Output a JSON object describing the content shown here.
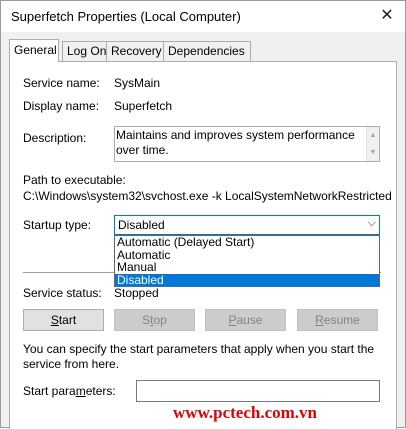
{
  "window": {
    "title": "Superfetch Properties (Local Computer)",
    "close_glyph": "✕"
  },
  "tabs": [
    {
      "label": "General",
      "active": true
    },
    {
      "label": "Log On",
      "active": false
    },
    {
      "label": "Recovery",
      "active": false
    },
    {
      "label": "Dependencies",
      "active": false
    }
  ],
  "general": {
    "service_name_label": "Service name:",
    "service_name_value": "SysMain",
    "display_name_label": "Display name:",
    "display_name_value": "Superfetch",
    "description_label": "Description:",
    "description_value": "Maintains and improves system performance over time.",
    "path_label": "Path to executable:",
    "path_value": "C:\\Windows\\system32\\svchost.exe -k LocalSystemNetworkRestricted",
    "startup_type_label": "Startup type:",
    "startup_type_value": "Disabled",
    "startup_options": [
      {
        "label": "Automatic (Delayed Start)",
        "selected": false
      },
      {
        "label": "Automatic",
        "selected": false
      },
      {
        "label": "Manual",
        "selected": false
      },
      {
        "label": "Disabled",
        "selected": true
      }
    ],
    "service_status_label": "Service status:",
    "service_status_value": "Stopped",
    "buttons": {
      "start": {
        "label": "Start",
        "mnemonic": "S",
        "rest": "tart",
        "enabled": true
      },
      "stop": {
        "label": "Stop",
        "mnemonic": "T",
        "rest": "op",
        "enabled": false
      },
      "pause": {
        "label": "Pause",
        "mnemonic": "P",
        "rest": "ause",
        "enabled": false
      },
      "resume": {
        "label": "Resume",
        "mnemonic": "R",
        "rest": "esume",
        "enabled": false
      }
    },
    "help_text": "You can specify the start parameters that apply when you start the service from here.",
    "start_params_label": "Start para",
    "start_params_mnemonic": "m",
    "start_params_label_rest": "eters:",
    "start_params_value": ""
  },
  "watermark": "www.pctech.com.vn",
  "colors": {
    "selection": "#0078d7",
    "watermark": "#e00000",
    "disabled_text": "#838383"
  },
  "icons": {
    "close": "close-icon",
    "dropdown": "chevron-down-icon",
    "scroll_up": "scroll-up-icon",
    "scroll_down": "scroll-down-icon"
  }
}
